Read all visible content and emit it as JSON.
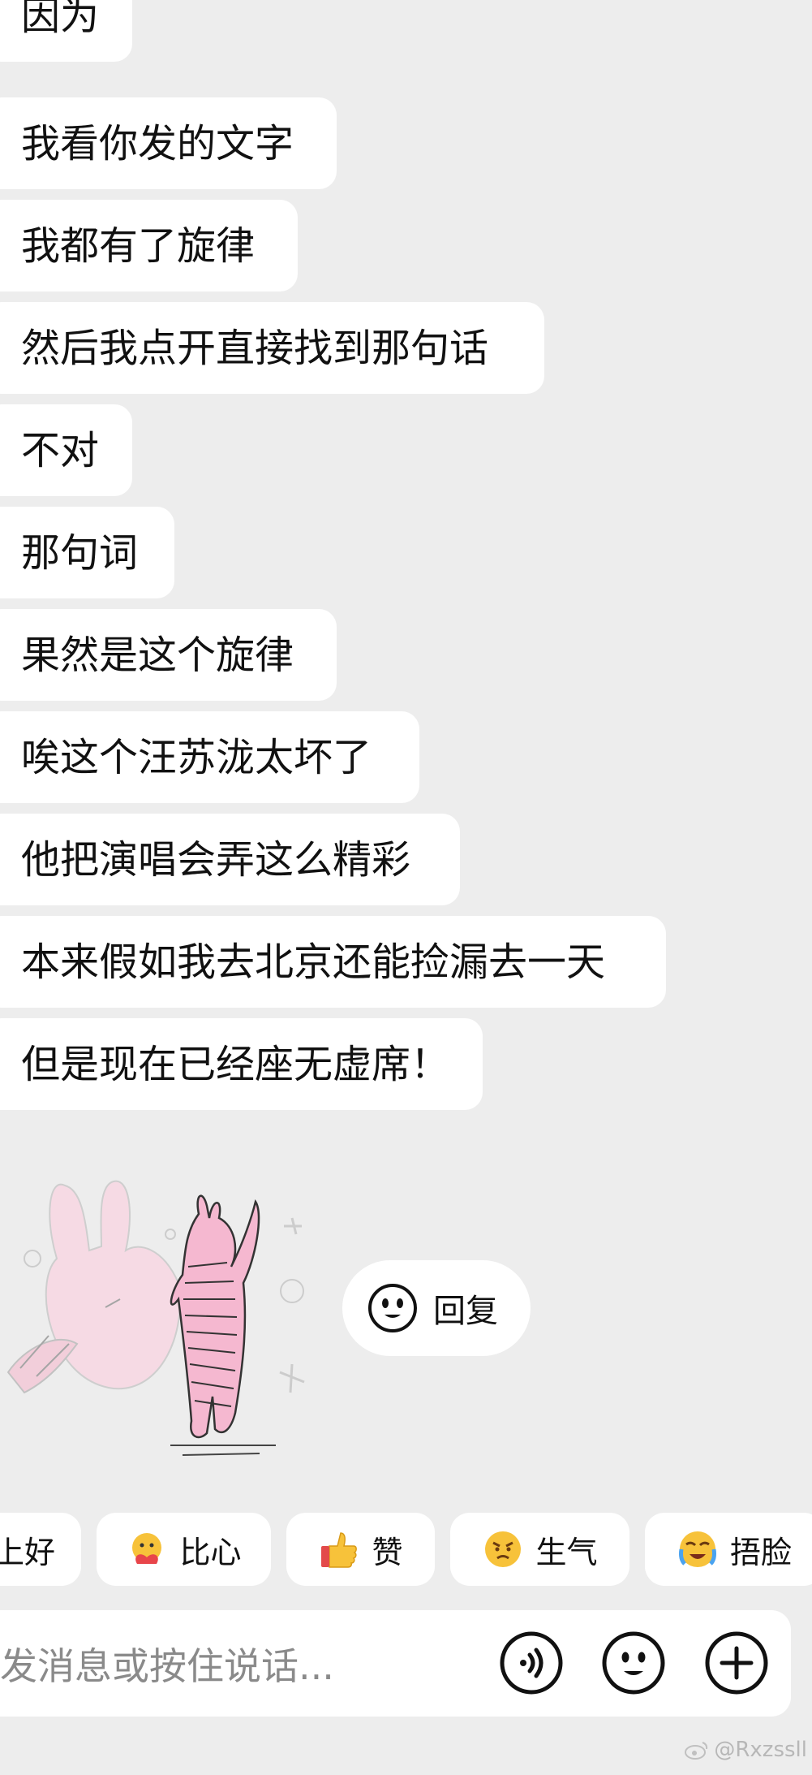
{
  "messages": [
    "因为",
    "我看你发的文字",
    "我都有了旋律",
    "然后我点开直接找到那句话",
    "不对",
    "那句词",
    "果然是这个旋律",
    "唉这个汪苏泷太坏了",
    "他把演唱会弄这么精彩",
    "本来假如我去北京还能捡漏去一天",
    "但是现在已经座无虚席！"
  ],
  "reply_pill": {
    "icon": "smile-face-icon",
    "label": "回复"
  },
  "quick_replies": [
    {
      "label": "上好",
      "icon": ""
    },
    {
      "label": "比心",
      "icon": "heart-hands-emoji-icon"
    },
    {
      "label": "赞",
      "icon": "thumbs-up-emoji-icon"
    },
    {
      "label": "生气",
      "icon": "angry-face-emoji-icon"
    },
    {
      "label": "捂脸",
      "icon": "facepalm-emoji-icon"
    }
  ],
  "input": {
    "placeholder": "发消息或按住说话..."
  },
  "toolbar_icons": [
    "voice-icon",
    "emoji-icon",
    "plus-icon"
  ],
  "watermark": "@Rxzssll",
  "colors": {
    "background": "#ededed",
    "bubble": "#ffffff",
    "sticker_pink": "#f5b8d0"
  }
}
